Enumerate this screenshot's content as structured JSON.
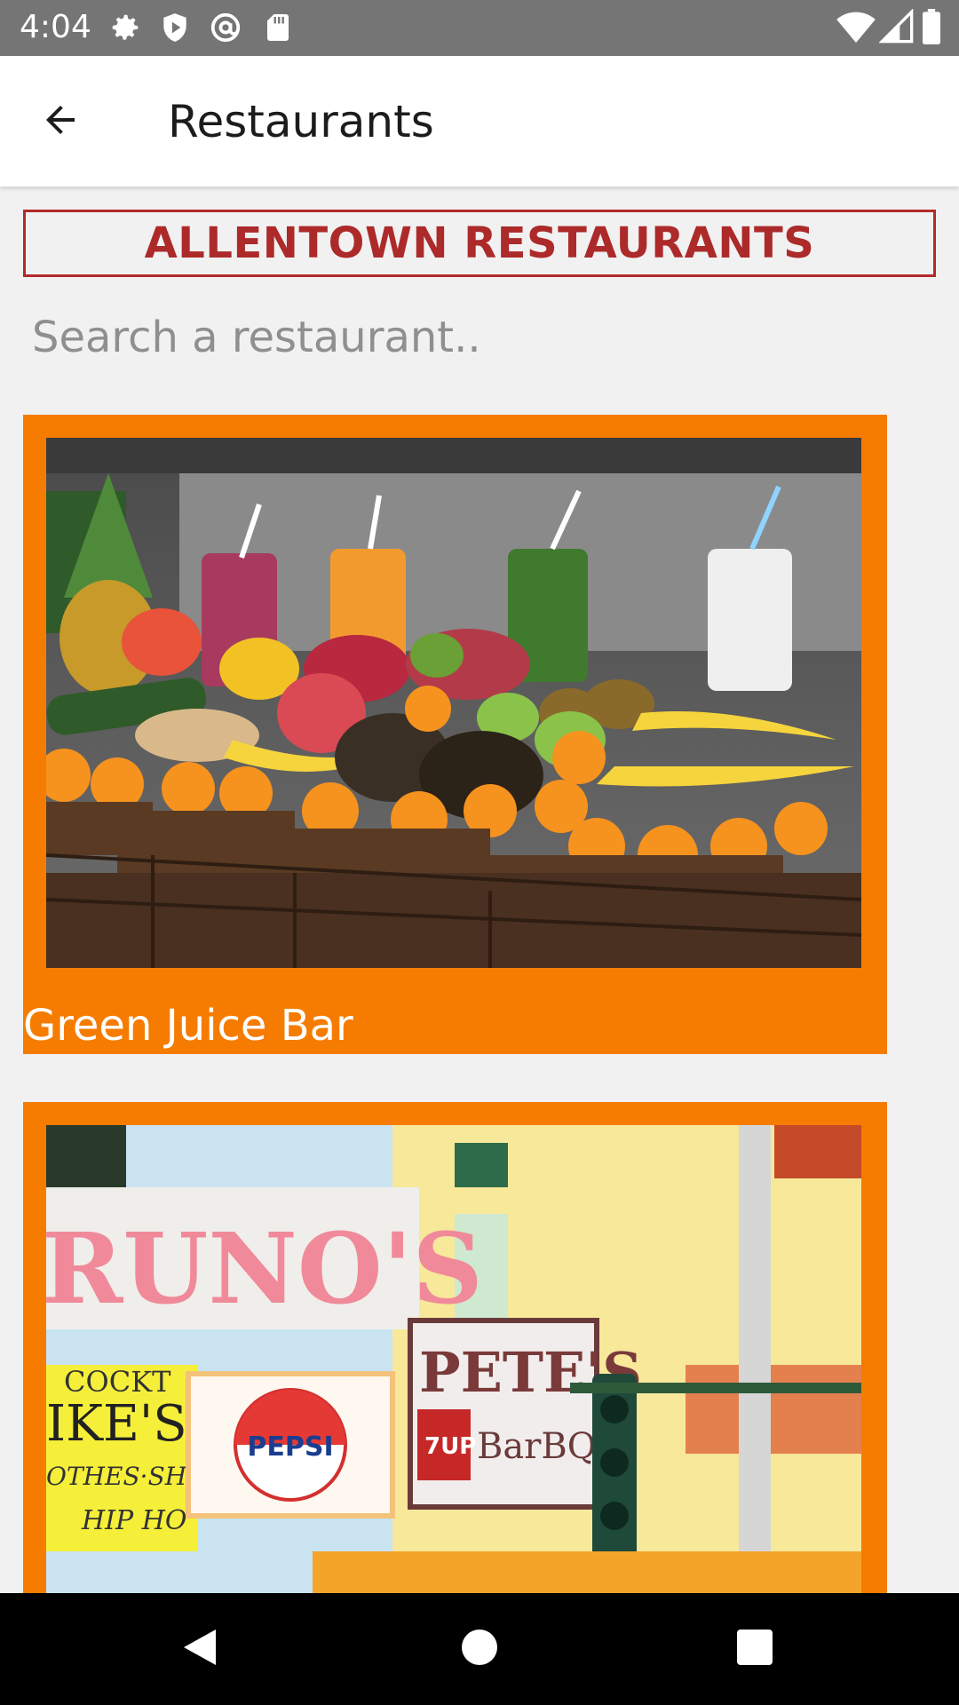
{
  "status_bar": {
    "time": "4:04",
    "left_icons": [
      "gear-icon",
      "shield-play-icon",
      "at-sign-icon",
      "sd-card-icon"
    ],
    "right_icons": [
      "wifi-icon",
      "signal-icon",
      "battery-icon"
    ]
  },
  "app_bar": {
    "back_icon": "arrow-back-icon",
    "title": "Restaurants"
  },
  "header": {
    "title": "ALLENTOWN RESTAURANTS",
    "border_color": "#b22a2a",
    "text_color": "#ad2a2a"
  },
  "search": {
    "placeholder": "Search a restaurant..",
    "value": ""
  },
  "restaurants": [
    {
      "name": "Green Juice Bar",
      "image": "fruit-and-juice-stand-photo"
    },
    {
      "name": "",
      "image": "street-signs-photo",
      "sign_texts": [
        "RUNO'S",
        "COCKT",
        "IKE'S",
        "OTHES·SHOES",
        "HIP HO",
        "PEPSI",
        "PETE'S",
        "7UP",
        "BarBQ"
      ]
    }
  ],
  "colors": {
    "card_background": "#f57c00",
    "status_bar": "#757575",
    "app_bar": "#ffffff",
    "page_background": "#f1f1f1",
    "nav_bar": "#000000"
  },
  "nav_bar": {
    "buttons": [
      "back-triangle-icon",
      "home-circle-icon",
      "recents-square-icon"
    ]
  }
}
